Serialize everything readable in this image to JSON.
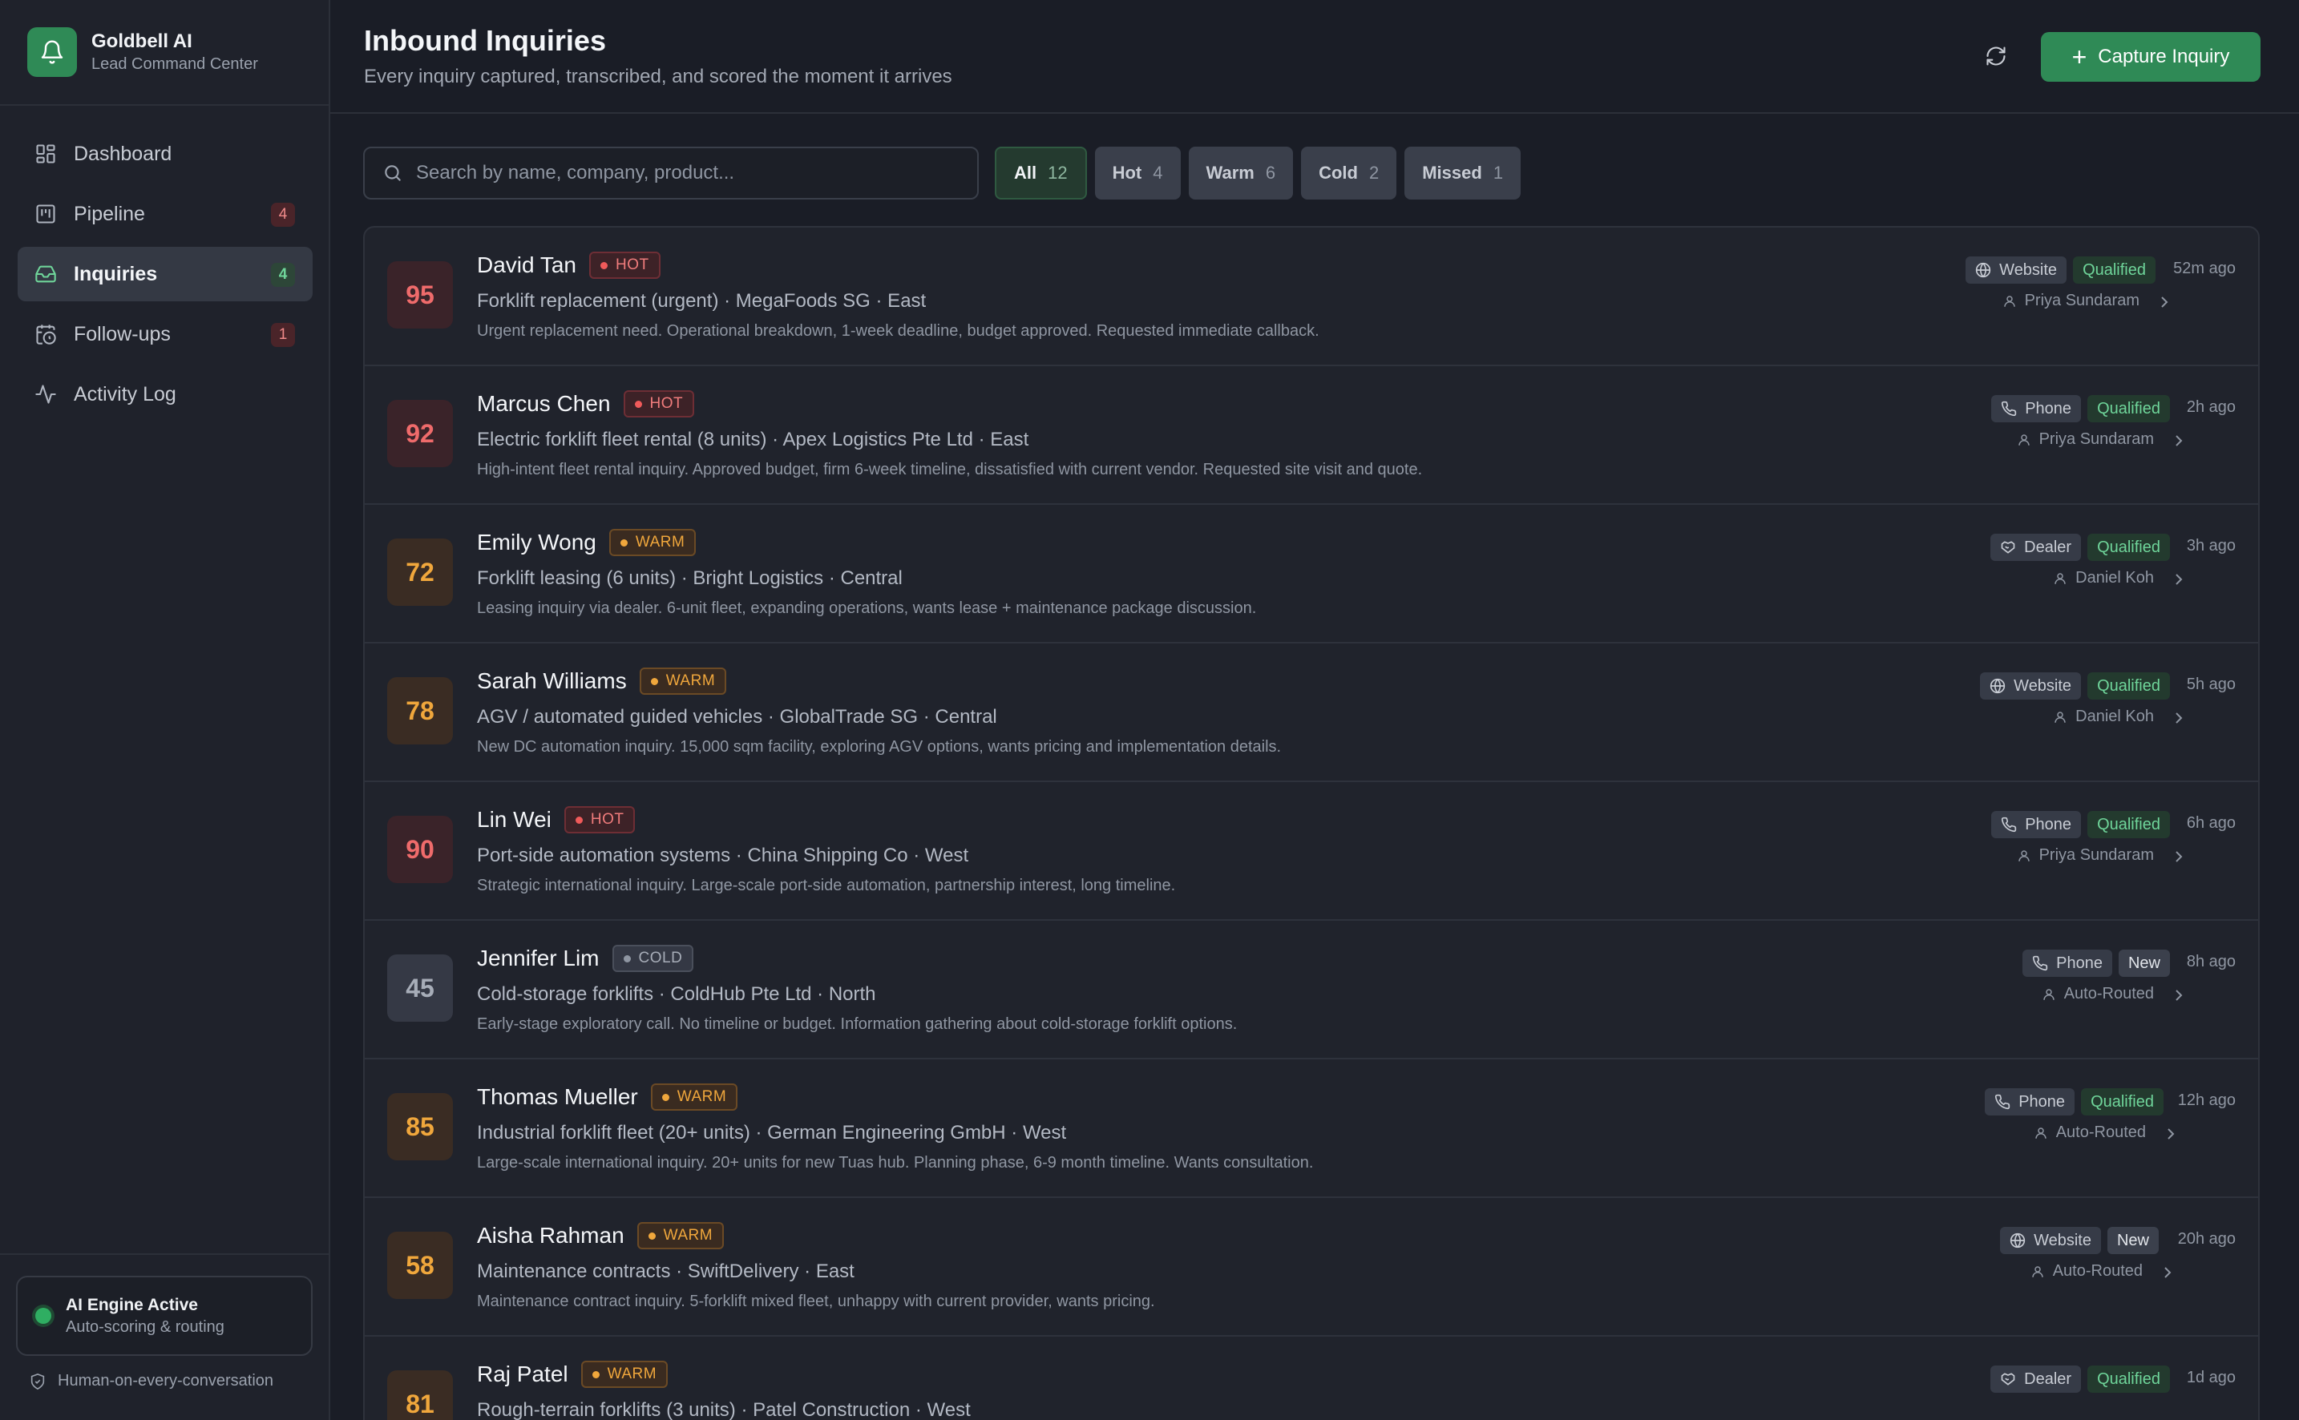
{
  "brand": {
    "name": "Goldbell AI",
    "subtitle": "Lead Command Center"
  },
  "nav": [
    {
      "label": "Dashboard",
      "icon": "grid-icon",
      "badge": ""
    },
    {
      "label": "Pipeline",
      "icon": "kanban-icon",
      "badge": "4",
      "badge_color": "red"
    },
    {
      "label": "Inquiries",
      "icon": "inbox-icon",
      "badge": "4",
      "badge_color": "green",
      "active": true
    },
    {
      "label": "Follow-ups",
      "icon": "calendar-clock-icon",
      "badge": "1",
      "badge_color": "red"
    },
    {
      "label": "Activity Log",
      "icon": "activity-icon",
      "badge": ""
    }
  ],
  "ai_status": {
    "title": "AI Engine Active",
    "subtitle": "Auto-scoring & routing"
  },
  "footer_note": "Human-on-every-conversation",
  "header": {
    "title": "Inbound Inquiries",
    "subtitle": "Every inquiry captured, transcribed, and scored the moment it arrives",
    "capture_label": "Capture Inquiry"
  },
  "search": {
    "placeholder": "Search by name, company, product...",
    "value": ""
  },
  "filters": [
    {
      "label": "All",
      "count": "12",
      "active": true
    },
    {
      "label": "Hot",
      "count": "4"
    },
    {
      "label": "Warm",
      "count": "6"
    },
    {
      "label": "Cold",
      "count": "2"
    },
    {
      "label": "Missed",
      "count": "1"
    }
  ],
  "colors": {
    "accent": "#2f8a56",
    "hot": "#ef6b6b",
    "warm": "#f0a73c",
    "cold": "#a7adb8",
    "background": "#1a1d26"
  },
  "inquiries": [
    {
      "score": "95",
      "name": "David Tan",
      "temp": "HOT",
      "product": "Forklift replacement (urgent) · MegaFoods SG · East",
      "summary": "Urgent replacement need. Operational breakdown, 1-week deadline, budget approved. Requested immediate callback.",
      "channel": "Website",
      "status": "Qualified",
      "owner": "Priya Sundaram",
      "time": "52m ago"
    },
    {
      "score": "92",
      "name": "Marcus Chen",
      "temp": "HOT",
      "product": "Electric forklift fleet rental (8 units) · Apex Logistics Pte Ltd · East",
      "summary": "High-intent fleet rental inquiry. Approved budget, firm 6-week timeline, dissatisfied with current vendor. Requested site visit and quote.",
      "channel": "Phone",
      "status": "Qualified",
      "owner": "Priya Sundaram",
      "time": "2h ago"
    },
    {
      "score": "72",
      "name": "Emily Wong",
      "temp": "WARM",
      "product": "Forklift leasing (6 units) · Bright Logistics · Central",
      "summary": "Leasing inquiry via dealer. 6-unit fleet, expanding operations, wants lease + maintenance package discussion.",
      "channel": "Dealer",
      "status": "Qualified",
      "owner": "Daniel Koh",
      "time": "3h ago"
    },
    {
      "score": "78",
      "name": "Sarah Williams",
      "temp": "WARM",
      "product": "AGV / automated guided vehicles · GlobalTrade SG · Central",
      "summary": "New DC automation inquiry. 15,000 sqm facility, exploring AGV options, wants pricing and implementation details.",
      "channel": "Website",
      "status": "Qualified",
      "owner": "Daniel Koh",
      "time": "5h ago"
    },
    {
      "score": "90",
      "name": "Lin Wei",
      "temp": "HOT",
      "product": "Port-side automation systems · China Shipping Co · West",
      "summary": "Strategic international inquiry. Large-scale port-side automation, partnership interest, long timeline.",
      "channel": "Phone",
      "status": "Qualified",
      "owner": "Priya Sundaram",
      "time": "6h ago"
    },
    {
      "score": "45",
      "name": "Jennifer Lim",
      "temp": "COLD",
      "product": "Cold-storage forklifts · ColdHub Pte Ltd · North",
      "summary": "Early-stage exploratory call. No timeline or budget. Information gathering about cold-storage forklift options.",
      "channel": "Phone",
      "status": "New",
      "owner": "Auto-Routed",
      "time": "8h ago"
    },
    {
      "score": "85",
      "name": "Thomas Mueller",
      "temp": "WARM",
      "product": "Industrial forklift fleet (20+ units) · German Engineering GmbH · West",
      "summary": "Large-scale international inquiry. 20+ units for new Tuas hub. Planning phase, 6-9 month timeline. Wants consultation.",
      "channel": "Phone",
      "status": "Qualified",
      "owner": "Auto-Routed",
      "time": "12h ago"
    },
    {
      "score": "58",
      "name": "Aisha Rahman",
      "temp": "WARM",
      "product": "Maintenance contracts · SwiftDelivery · East",
      "summary": "Maintenance contract inquiry. 5-forklift mixed fleet, unhappy with current provider, wants pricing.",
      "channel": "Website",
      "status": "New",
      "owner": "Auto-Routed",
      "time": "20h ago"
    },
    {
      "score": "81",
      "name": "Raj Patel",
      "temp": "WARM",
      "product": "Rough-terrain forklifts (3 units) · Patel Construction · West",
      "summary": "",
      "channel": "Dealer",
      "status": "Qualified",
      "owner": "",
      "time": "1d ago"
    }
  ]
}
